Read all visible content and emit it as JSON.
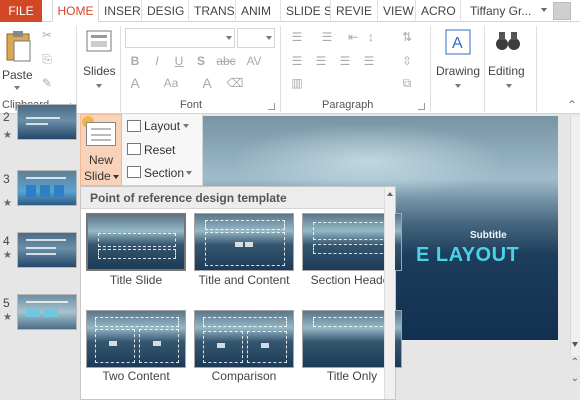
{
  "tabs": [
    "FILE",
    "HOME",
    "INSER",
    "DESIG",
    "TRANS",
    "ANIM",
    "SLIDE S",
    "REVIE",
    "VIEW",
    "ACRO"
  ],
  "active_tab": "HOME",
  "user_name": "Tiffany Gr...",
  "ribbon": {
    "clipboard": {
      "paste_label": "Paste",
      "group_label": "Clipboard"
    },
    "slides": {
      "slides_label": "Slides"
    },
    "font": {
      "group_label": "Font",
      "bold": "B",
      "italic": "I",
      "underline": "U",
      "shadow": "S",
      "strike": "abc",
      "spacing": "AV",
      "case": "Aa",
      "grow": "A",
      "color": "A"
    },
    "paragraph": {
      "group_label": "Paragraph"
    },
    "drawing": {
      "label": "Drawing"
    },
    "editing": {
      "label": "Editing"
    }
  },
  "slides_menu": {
    "new_slide_line1": "New",
    "new_slide_line2": "Slide",
    "layout": "Layout",
    "reset": "Reset",
    "section": "Section"
  },
  "gallery": {
    "title": "Point of reference design template",
    "items": [
      "Title Slide",
      "Title and Content",
      "Section Header",
      "Two Content",
      "Comparison",
      "Title Only"
    ],
    "selected_index": 0
  },
  "thumbnails": [
    {
      "number": "2"
    },
    {
      "number": "3"
    },
    {
      "number": "4"
    },
    {
      "number": "5"
    }
  ],
  "slide": {
    "subtitle": "Subtitle",
    "title_visible": "E LAYOUT"
  },
  "colors": {
    "file_tab": "#d24726",
    "accent": "#d24726",
    "new_slide_highlight": "#f9d3b9",
    "slide_title": "#49d3e6"
  }
}
